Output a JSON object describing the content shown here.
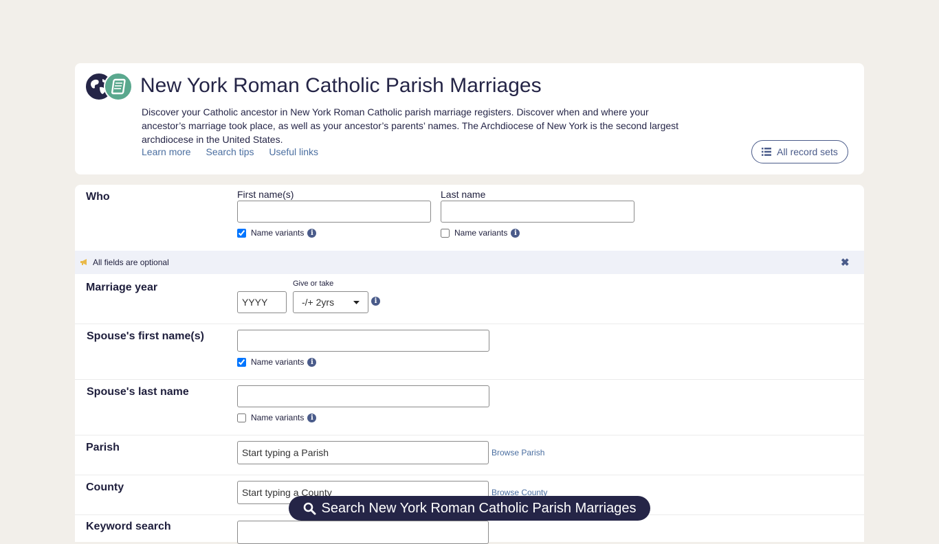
{
  "header": {
    "title": "New York Roman Catholic Parish Marriages",
    "description": "Discover your Catholic ancestor in New York Roman Catholic parish marriage registers. Discover when and where your ancestor’s marriage took place, as well as your ancestor’s parents’ names. The Archdiocese of New York is the second largest archdiocese in the United States.",
    "links": [
      "Learn more",
      "Search tips",
      "Useful links"
    ],
    "all_record_sets": "All record sets"
  },
  "form": {
    "who": {
      "label": "Who",
      "first_name_label": "First name(s)",
      "first_name_value": "",
      "first_name_variants": "Name variants",
      "first_name_variants_checked": true,
      "last_name_label": "Last name",
      "last_name_value": "",
      "last_name_variants": "Name variants",
      "last_name_variants_checked": false
    },
    "notice": "All fields are optional",
    "marriage_year": {
      "label": "Marriage year",
      "placeholder": "YYYY",
      "give_or_take_label": "Give or take",
      "give_or_take_value": "-/+ 2yrs"
    },
    "spouse_first": {
      "label": "Spouse's first name(s)",
      "value": "",
      "variants": "Name variants",
      "variants_checked": true
    },
    "spouse_last": {
      "label": "Spouse's last name",
      "value": "",
      "variants": "Name variants",
      "variants_checked": false
    },
    "parish": {
      "label": "Parish",
      "placeholder": "Start typing a Parish",
      "browse": "Browse Parish"
    },
    "county": {
      "label": "County",
      "placeholder": "Start typing a County",
      "browse": "Browse County"
    },
    "keyword": {
      "label": "Keyword search"
    }
  },
  "search_button": "Search New York Roman Catholic Parish Marriages",
  "colors": {
    "page_bg": "#f2efea",
    "navy": "#252547",
    "link": "#4a6ea0",
    "notice_bg": "#eff1f8",
    "book_green": "#5aa88e"
  }
}
